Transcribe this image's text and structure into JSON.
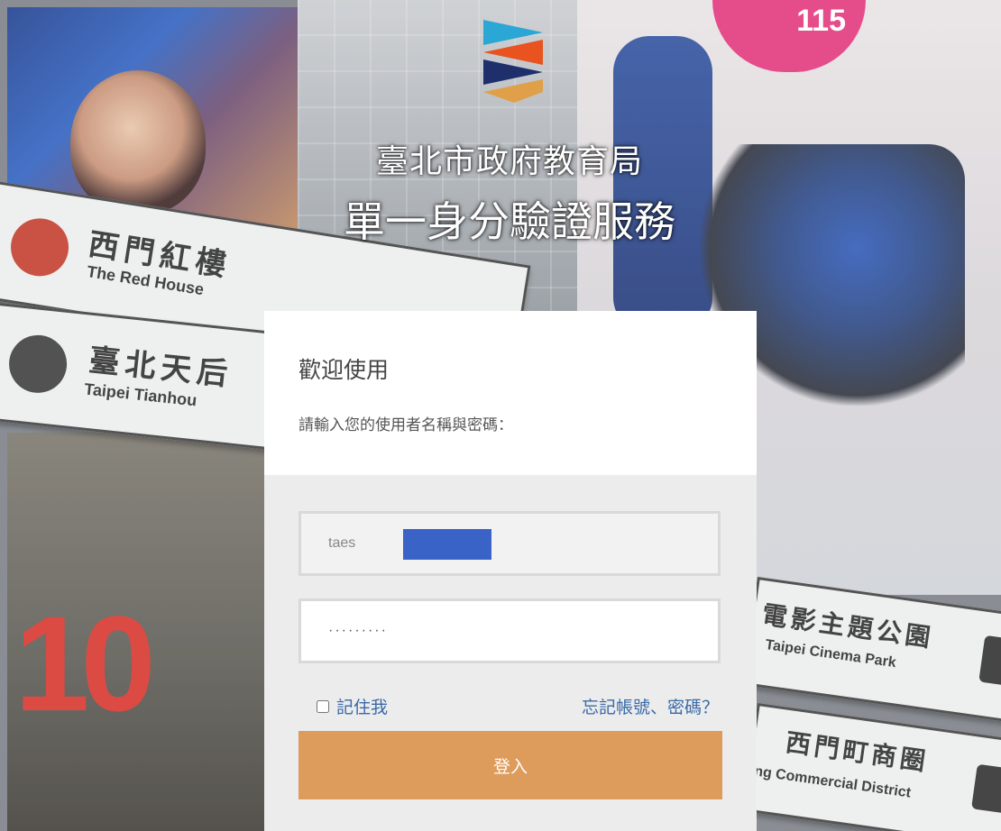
{
  "background": {
    "sign_red_zh": "西門紅樓",
    "sign_red_en": "The Red House",
    "sign_tianhou_zh": "臺北天后",
    "sign_tianhou_en": "Taipei Tianhou",
    "sign_cinema_zh": "電影主題公園",
    "sign_cinema_en": "Taipei Cinema Park",
    "sign_ximen_zh": "西門町商圈",
    "sign_ximen_en": "ng Commercial District",
    "billboard_number": "115"
  },
  "header": {
    "org_name": "臺北市政府教育局",
    "service_name": "單一身分驗證服務"
  },
  "login": {
    "welcome": "歡迎使用",
    "prompt": "請輸入您的使用者名稱與密碼：",
    "username_value": "taes",
    "password_value": "·········",
    "remember_label": "記住我",
    "forgot_label": "忘記帳號、密碼？",
    "submit_label": "登入"
  },
  "colors": {
    "button": "#dd9b5c",
    "link": "#3a6aa8",
    "redaction": "#3a63c8"
  }
}
